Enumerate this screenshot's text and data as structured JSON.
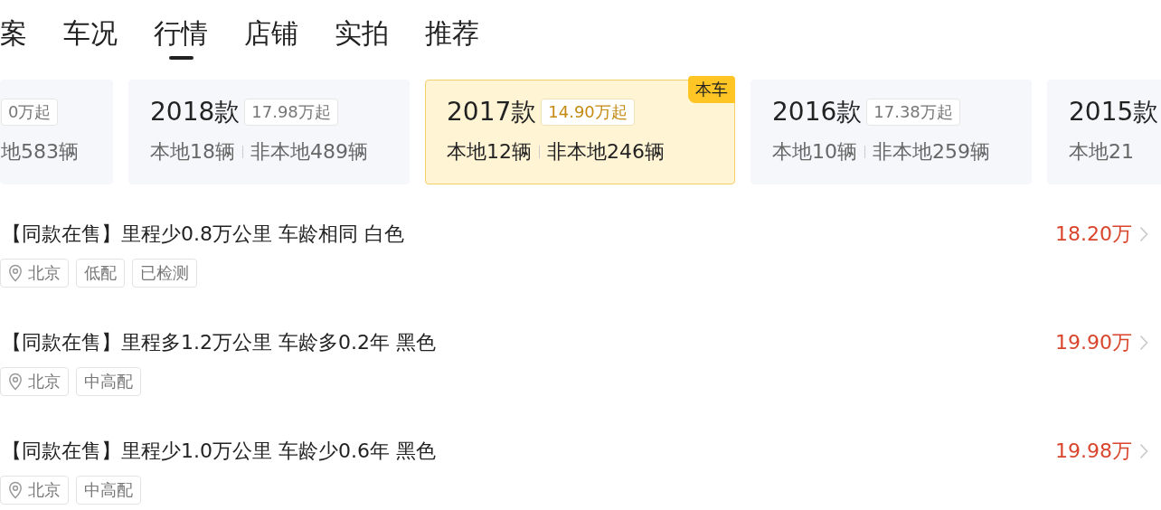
{
  "tabs": [
    {
      "label": "案",
      "selected": false
    },
    {
      "label": "车况",
      "selected": false
    },
    {
      "label": "行情",
      "selected": true
    },
    {
      "label": "店铺",
      "selected": false
    },
    {
      "label": "实拍",
      "selected": false
    },
    {
      "label": "推荐",
      "selected": false
    }
  ],
  "model_cards": [
    {
      "price": "0万起",
      "local": "地583辆",
      "selected": false
    },
    {
      "year": "2018款",
      "price": "17.98万起",
      "local": "本地18辆",
      "nonlocal": "非本地489辆",
      "selected": false
    },
    {
      "year": "2017款",
      "price": "14.90万起",
      "local": "本地12辆",
      "nonlocal": "非本地246辆",
      "selected": true,
      "badge": "本车"
    },
    {
      "year": "2016款",
      "price": "17.38万起",
      "local": "本地10辆",
      "nonlocal": "非本地259辆",
      "selected": false
    },
    {
      "year": "2015款",
      "local": "本地21",
      "selected": false
    }
  ],
  "listings": [
    {
      "title": "【同款在售】里程少0.8万公里 车龄相同 白色",
      "price": "18.20万",
      "tags": [
        {
          "kind": "location",
          "label": "北京"
        },
        {
          "kind": "plain",
          "label": "低配"
        },
        {
          "kind": "plain",
          "label": "已检测"
        }
      ]
    },
    {
      "title": "【同款在售】里程多1.2万公里 车龄多0.2年 黑色",
      "price": "19.90万",
      "tags": [
        {
          "kind": "location",
          "label": "北京"
        },
        {
          "kind": "plain",
          "label": "中高配"
        }
      ]
    },
    {
      "title": "【同款在售】里程少1.0万公里 车龄少0.6年 黑色",
      "price": "19.98万",
      "tags": [
        {
          "kind": "location",
          "label": "北京"
        },
        {
          "kind": "plain",
          "label": "中高配"
        }
      ]
    }
  ]
}
